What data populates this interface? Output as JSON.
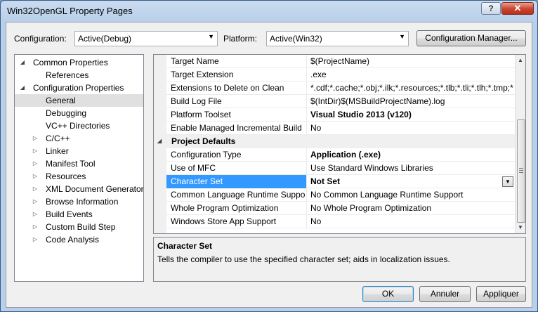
{
  "window": {
    "title": "Win32OpenGL Property Pages",
    "help_label": "?",
    "close_label": "✕"
  },
  "top": {
    "configuration_label": "Configuration:",
    "configuration_value": "Active(Debug)",
    "platform_label": "Platform:",
    "platform_value": "Active(Win32)",
    "configuration_manager_label": "Configuration Manager..."
  },
  "tree": {
    "items": [
      {
        "label": "Common Properties",
        "twisty": "◢",
        "level": 0
      },
      {
        "label": "References",
        "twisty": "",
        "level": 1
      },
      {
        "label": "Configuration Properties",
        "twisty": "◢",
        "level": 0
      },
      {
        "label": "General",
        "twisty": "",
        "level": 1,
        "selected": true
      },
      {
        "label": "Debugging",
        "twisty": "",
        "level": 1
      },
      {
        "label": "VC++ Directories",
        "twisty": "",
        "level": 1
      },
      {
        "label": "C/C++",
        "twisty": "▷",
        "level": 1
      },
      {
        "label": "Linker",
        "twisty": "▷",
        "level": 1
      },
      {
        "label": "Manifest Tool",
        "twisty": "▷",
        "level": 1
      },
      {
        "label": "Resources",
        "twisty": "▷",
        "level": 1
      },
      {
        "label": "XML Document Generator",
        "twisty": "▷",
        "level": 1
      },
      {
        "label": "Browse Information",
        "twisty": "▷",
        "level": 1
      },
      {
        "label": "Build Events",
        "twisty": "▷",
        "level": 1
      },
      {
        "label": "Custom Build Step",
        "twisty": "▷",
        "level": 1
      },
      {
        "label": "Code Analysis",
        "twisty": "▷",
        "level": 1
      }
    ]
  },
  "grid": {
    "rows": [
      {
        "name": "Target Name",
        "value": "$(ProjectName)"
      },
      {
        "name": "Target Extension",
        "value": ".exe"
      },
      {
        "name": "Extensions to Delete on Clean",
        "value": "*.cdf;*.cache;*.obj;*.ilk;*.resources;*.tlb;*.tli;*.tlh;*.tmp;*"
      },
      {
        "name": "Build Log File",
        "value": "$(IntDir)$(MSBuildProjectName).log"
      },
      {
        "name": "Platform Toolset",
        "value": "Visual Studio 2013 (v120)",
        "bold": true
      },
      {
        "name": "Enable Managed Incremental Build",
        "value": "No"
      },
      {
        "category": "Project Defaults",
        "twisty": "◢"
      },
      {
        "name": "Configuration Type",
        "value": "Application (.exe)",
        "bold": true
      },
      {
        "name": "Use of MFC",
        "value": "Use Standard Windows Libraries"
      },
      {
        "name": "Character Set",
        "value": "Not Set",
        "bold": true,
        "selected": true
      },
      {
        "name": "Common Language Runtime Support",
        "value": "No Common Language Runtime Support"
      },
      {
        "name": "Whole Program Optimization",
        "value": "No Whole Program Optimization"
      },
      {
        "name": "Windows Store App Support",
        "value": "No"
      }
    ]
  },
  "description": {
    "title": "Character Set",
    "text": "Tells the compiler to use the specified character set; aids in localization issues."
  },
  "buttons": {
    "ok": "OK",
    "cancel": "Annuler",
    "apply": "Appliquer"
  },
  "colors": {
    "selection": "#3399ff",
    "close": "#c9432e"
  }
}
